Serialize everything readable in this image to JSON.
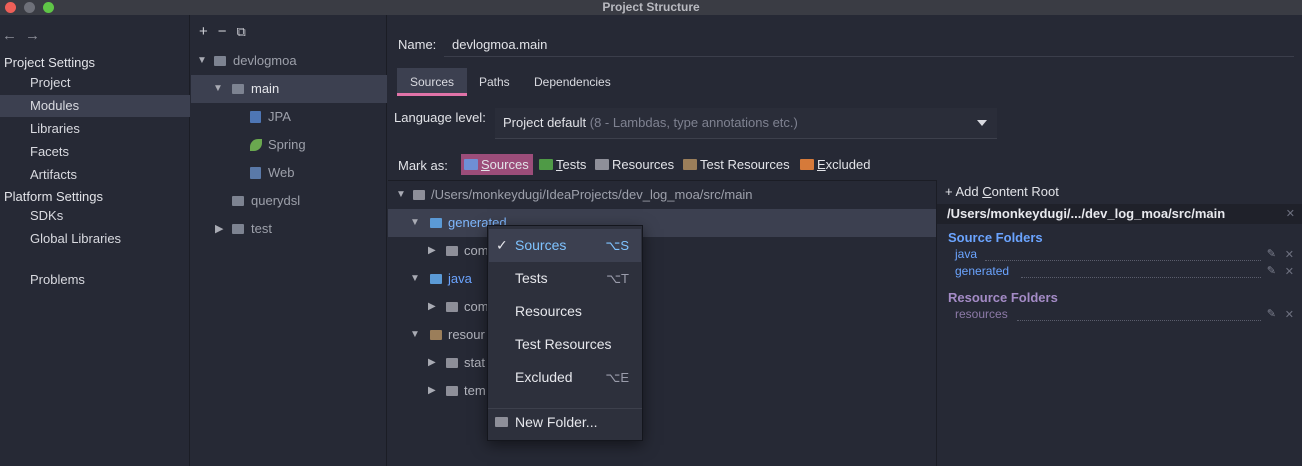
{
  "window": {
    "title": "Project Structure"
  },
  "colors": {
    "accent": "#e173a8",
    "sources": "#5b7fc9",
    "tests": "#4f9a46",
    "resources": "#9b7e5a",
    "excluded": "#d67a3a",
    "link": "#6ba4ff",
    "resource_link": "#a48bc6"
  },
  "nav": {
    "back_icon": "←",
    "forward_icon": "→",
    "project_settings": "Project Settings",
    "project_items": [
      "Project",
      "Modules",
      "Libraries",
      "Facets",
      "Artifacts"
    ],
    "platform_settings": "Platform Settings",
    "platform_items": [
      "SDKs",
      "Global Libraries"
    ],
    "problems": "Problems",
    "selected": "Modules"
  },
  "module_tree": {
    "toolbar": {
      "add": "+",
      "remove": "−",
      "copy": "⧉"
    },
    "items": [
      {
        "label": "devlogmoa"
      },
      {
        "label": "main"
      },
      {
        "label": "JPA"
      },
      {
        "label": "Spring"
      },
      {
        "label": "Web"
      },
      {
        "label": "querydsl"
      },
      {
        "label": "test"
      }
    ]
  },
  "main": {
    "name_label": "Name:",
    "name_value": "devlogmoa.main",
    "tabs": [
      "Sources",
      "Paths",
      "Dependencies"
    ],
    "language_label": "Language level:",
    "language_value": "Project default",
    "language_hint": "(8 - Lambdas, type annotations etc.)",
    "mark_as_label": "Mark as:",
    "mark_buttons": {
      "sources_underlined": "S",
      "sources_rest": "ources",
      "tests_underlined": "T",
      "tests_rest": "ests",
      "resources": "Resources",
      "test_resources": "Test Resources",
      "excluded_underlined": "E",
      "excluded_rest": "xcluded"
    }
  },
  "folder_tree": {
    "root": "/Users/monkeydugi/IdeaProjects/dev_log_moa/src/main",
    "rows": [
      {
        "label": "generated"
      },
      {
        "label": "com"
      },
      {
        "label": "java"
      },
      {
        "label": "com"
      },
      {
        "label": "resour"
      },
      {
        "label": "stat"
      },
      {
        "label": "tem"
      }
    ]
  },
  "content_root": {
    "add_label_pre": "+ Add ",
    "add_label_underlined": "C",
    "add_label_post": "ontent Root",
    "path": "/Users/monkeydugi/.../dev_log_moa/src/main",
    "source_folders_title": "Source Folders",
    "source_folders": [
      "java",
      "generated"
    ],
    "resource_folders_title": "Resource Folders",
    "resource_folders": [
      "resources"
    ]
  },
  "context_menu": {
    "items": [
      {
        "label": "Sources",
        "shortcut": "⌥S",
        "checked": "✓"
      },
      {
        "label": "Tests",
        "shortcut": "⌥T"
      },
      {
        "label": "Resources",
        "shortcut": ""
      },
      {
        "label": "Test Resources",
        "shortcut": ""
      },
      {
        "label": "Excluded",
        "shortcut": "⌥E"
      }
    ],
    "new_folder": "New Folder..."
  }
}
